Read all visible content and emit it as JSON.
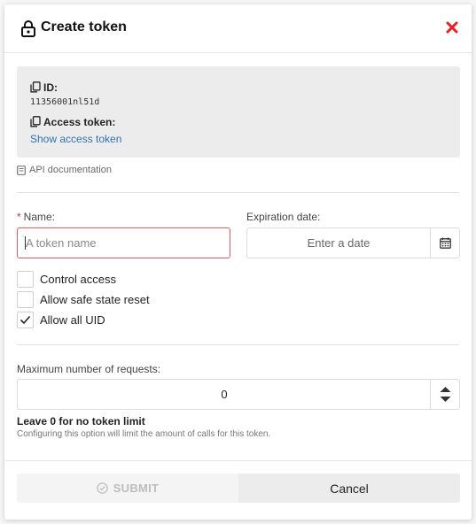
{
  "modal": {
    "title": "Create token",
    "close_label": "×"
  },
  "info": {
    "id_label": "ID:",
    "id_value": "11356001nl51d",
    "access_token_label": "Access token:",
    "show_token_link": "Show access token"
  },
  "api_doc_link": "API documentation",
  "form": {
    "name_label": "Name:",
    "name_required_marker": "*",
    "name_value": "",
    "name_placeholder": "A token name",
    "expiration_label": "Expiration date:",
    "expiration_placeholder": "Enter a date",
    "checkboxes": [
      {
        "label": "Control access",
        "checked": false
      },
      {
        "label": "Allow safe state reset",
        "checked": false
      },
      {
        "label": "Allow all UID",
        "checked": true
      }
    ],
    "max_requests_label": "Maximum number of requests:",
    "max_requests_value": "0",
    "limit_hint_title": "Leave 0 for no token limit",
    "limit_hint_text": "Configuring this option will limit the amount of calls for this token."
  },
  "footer": {
    "submit_label": "SUBMIT",
    "cancel_label": "Cancel"
  },
  "colors": {
    "close": "#e82020",
    "link": "#2f72b8",
    "error_border": "#e35d5d"
  }
}
